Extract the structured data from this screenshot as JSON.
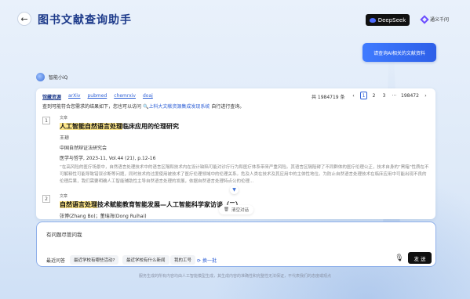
{
  "header": {
    "back_icon": "arrow-left-icon",
    "title": "图书文献查询助手",
    "deepseek_label": "DeepSeek",
    "tongyi_label": "通义千问"
  },
  "user_message": "请查询AI相关的文献资料",
  "assistant": {
    "name": "智能小iQ"
  },
  "results": {
    "tabs": [
      "馆藏资源",
      "arXiv",
      "pubmed",
      "chemrxiv",
      "doaj"
    ],
    "hint_prefix": "查到可能符合您需求的结果如下，您也可以访问",
    "hint_link": "上科大文献资源集成发现系统",
    "hint_suffix": "自行进行查询。",
    "total": "共 1984719 条",
    "pager": {
      "prev": "‹",
      "pages": [
        "1",
        "2",
        "3"
      ],
      "ellipsis": "···",
      "last": "198472",
      "next": "›"
    },
    "items": [
      {
        "num": "1",
        "type": "文章",
        "title_hl": "人工智能自然语言处理",
        "title_rest": "临床应用的伦理研究",
        "author": "王琼",
        "publisher": "中国自然辩证法研究会",
        "source": "医学与哲学, 2023-11, Vol.44 (21), p.12-16",
        "abstract": "“在高风险的医疗场景中，自然语言处理技术中的语言区隔和技术内在设计缺陷可能对诊疗行为和医疗体系带来严重风险。其语言区隔阻碍了不同群体的医疗伦理公正，技术自身的“黑箱”性质在不可解释性可能导致错误诊断等问题，同时技术的过度使用被技术了医疗伦理领域中的伦理关系。危及人类在技术及其应用中的主体性地位。为防止自然语言处理技术在临床应用中可能出现不良的伦理后果，我们需要明确人工智能辅助性主导自然语言处理的发展，依据自然语言处理特点公的伦理..."
      },
      {
        "num": "2",
        "type": "文章",
        "title_hl": "自然语言处理",
        "title_rest": "技术赋能教育智能发展—人工智能科学家访谈（二）",
        "author": "张博(Zhang Bo)；董瑞海(Dong Ruihai)"
      }
    ]
  },
  "clear_chat": "清空对话",
  "input": {
    "value": "有问题尽管问我",
    "recent_label": "最近问答",
    "recent": [
      "最近学校有哪些活动?",
      "最近学校有什么新闻",
      "我的工号"
    ],
    "refresh": "换一批",
    "send": "发 送"
  },
  "disclaimer": "服务生成的所有内容均由人工智能模型生成，其生成内容的准确性和完整性无法保证，不代表我们的态度或观点"
}
